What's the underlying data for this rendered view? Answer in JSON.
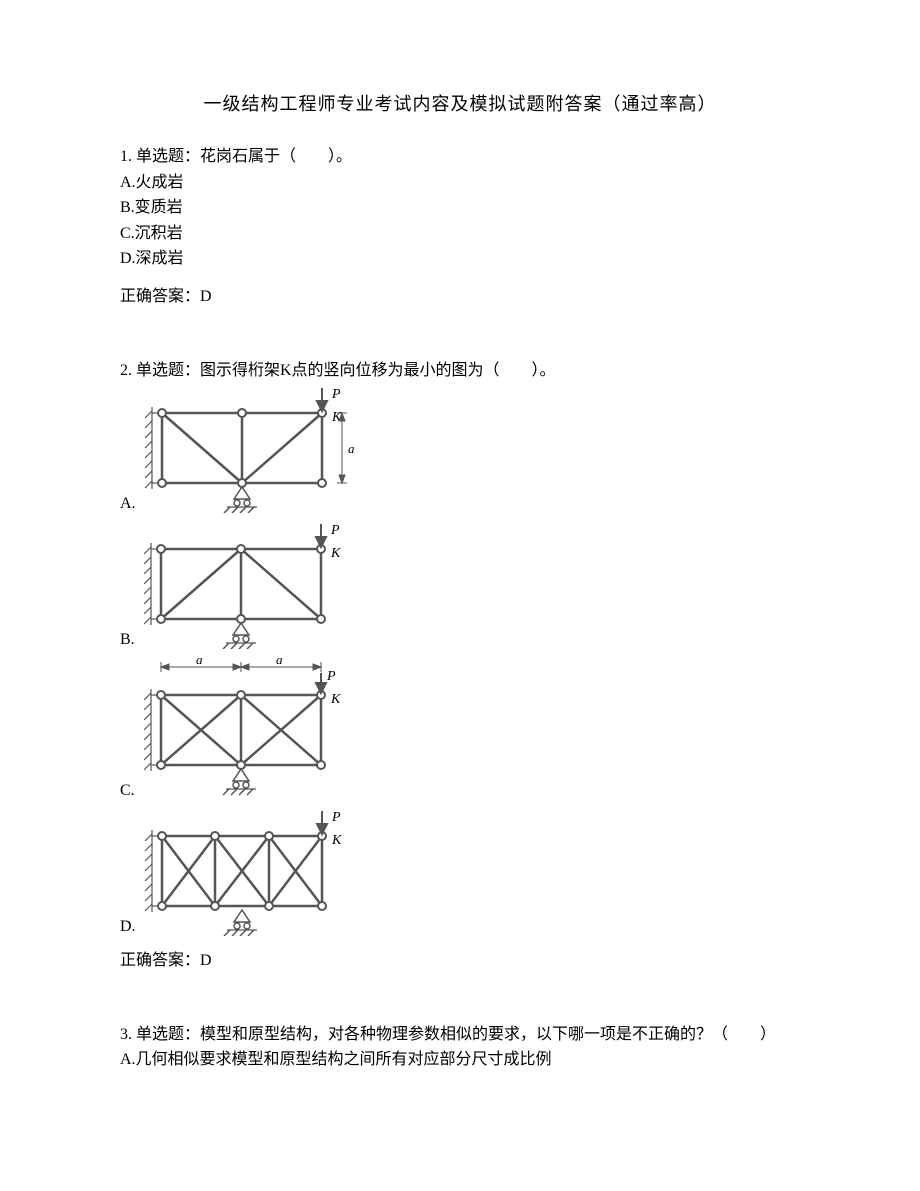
{
  "title": "一级结构工程师专业考试内容及模拟试题附答案（通过率高）",
  "q1": {
    "stem": "1. 单选题：花岗石属于（　　）。",
    "A": "A.火成岩",
    "B": "B.变质岩",
    "C": "C.沉积岩",
    "D": "D.深成岩",
    "answer": "正确答案：D"
  },
  "q2": {
    "stem": "2. 单选题：图示得桁架K点的竖向位移为最小的图为（　　）。",
    "A_label": "A.",
    "B_label": "B.",
    "C_label": "C.",
    "D_label": "D.",
    "P": "P",
    "K": "K",
    "a": "a",
    "answer": "正确答案：D"
  },
  "q3": {
    "stem": "3. 单选题：模型和原型结构，对各种物理参数相似的要求，以下哪一项是不正确的？（　　）",
    "A": "A.几何相似要求模型和原型结构之间所有对应部分尺寸成比例"
  }
}
